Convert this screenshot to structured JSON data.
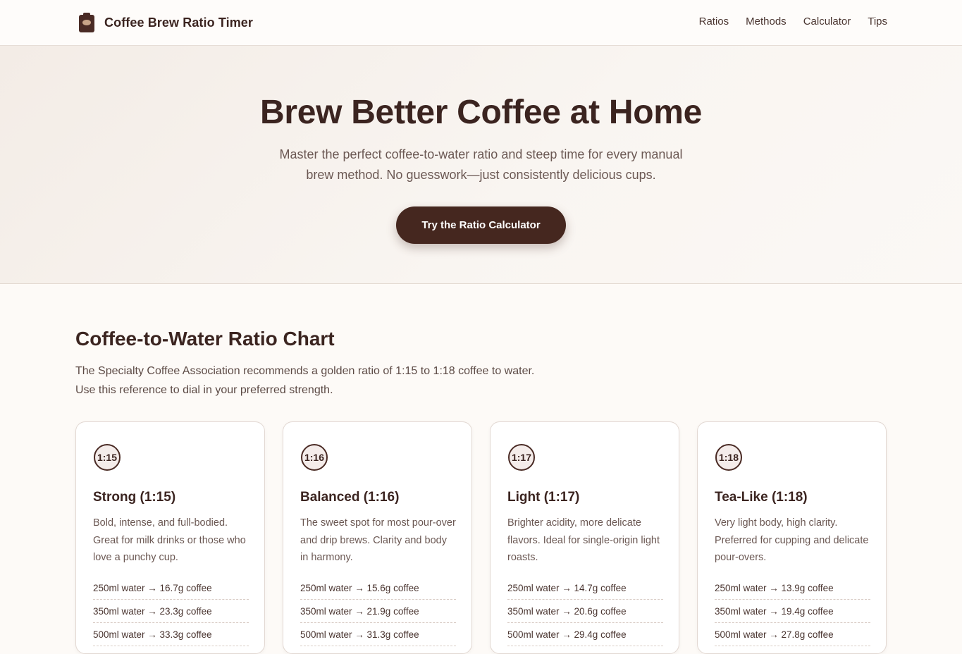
{
  "brand": {
    "name": "Coffee Brew Ratio Timer",
    "logo_icon": "coffee-bag-icon"
  },
  "nav": {
    "links": [
      "Ratios",
      "Methods",
      "Calculator",
      "Tips"
    ]
  },
  "hero": {
    "title": "Brew Better Coffee at Home",
    "subtitle": "Master the perfect coffee-to-water ratio and steep time for every manual brew method. No guesswork—just consistently delicious cups.",
    "cta_label": "Try the Ratio Calculator"
  },
  "ratio_section": {
    "title": "Coffee-to-Water Ratio Chart",
    "description_line1": "The Specialty Coffee Association recommends a golden ratio of 1:15 to 1:18 coffee to water.",
    "description_line2": "Use this reference to dial in your preferred strength.",
    "cards": [
      {
        "badge": "1:15",
        "title": "Strong (1:15)",
        "description": "Bold, intense, and full-bodied. Great for milk drinks or those who love a punchy cup.",
        "rows": [
          "250ml water → 16.7g coffee",
          "350ml water → 23.3g coffee",
          "500ml water → 33.3g coffee"
        ]
      },
      {
        "badge": "1:16",
        "title": "Balanced (1:16)",
        "description": "The sweet spot for most pour-over and drip brews. Clarity and body in harmony.",
        "rows": [
          "250ml water → 15.6g coffee",
          "350ml water → 21.9g coffee",
          "500ml water → 31.3g coffee"
        ]
      },
      {
        "badge": "1:17",
        "title": "Light (1:17)",
        "description": "Brighter acidity, more delicate flavors. Ideal for single-origin light roasts.",
        "rows": [
          "250ml water → 14.7g coffee",
          "350ml water → 20.6g coffee",
          "500ml water → 29.4g coffee"
        ]
      },
      {
        "badge": "1:18",
        "title": "Tea-Like (1:18)",
        "description": "Very light body, high clarity. Preferred for cupping and delicate pour-overs.",
        "rows": [
          "250ml water → 13.9g coffee",
          "350ml water → 19.4g coffee",
          "500ml water → 27.8g coffee"
        ]
      }
    ]
  },
  "colors": {
    "accent_dark": "#45271f",
    "text_primary": "#3b2420",
    "text_muted": "#6b5853",
    "background": "#fdfaf7"
  }
}
